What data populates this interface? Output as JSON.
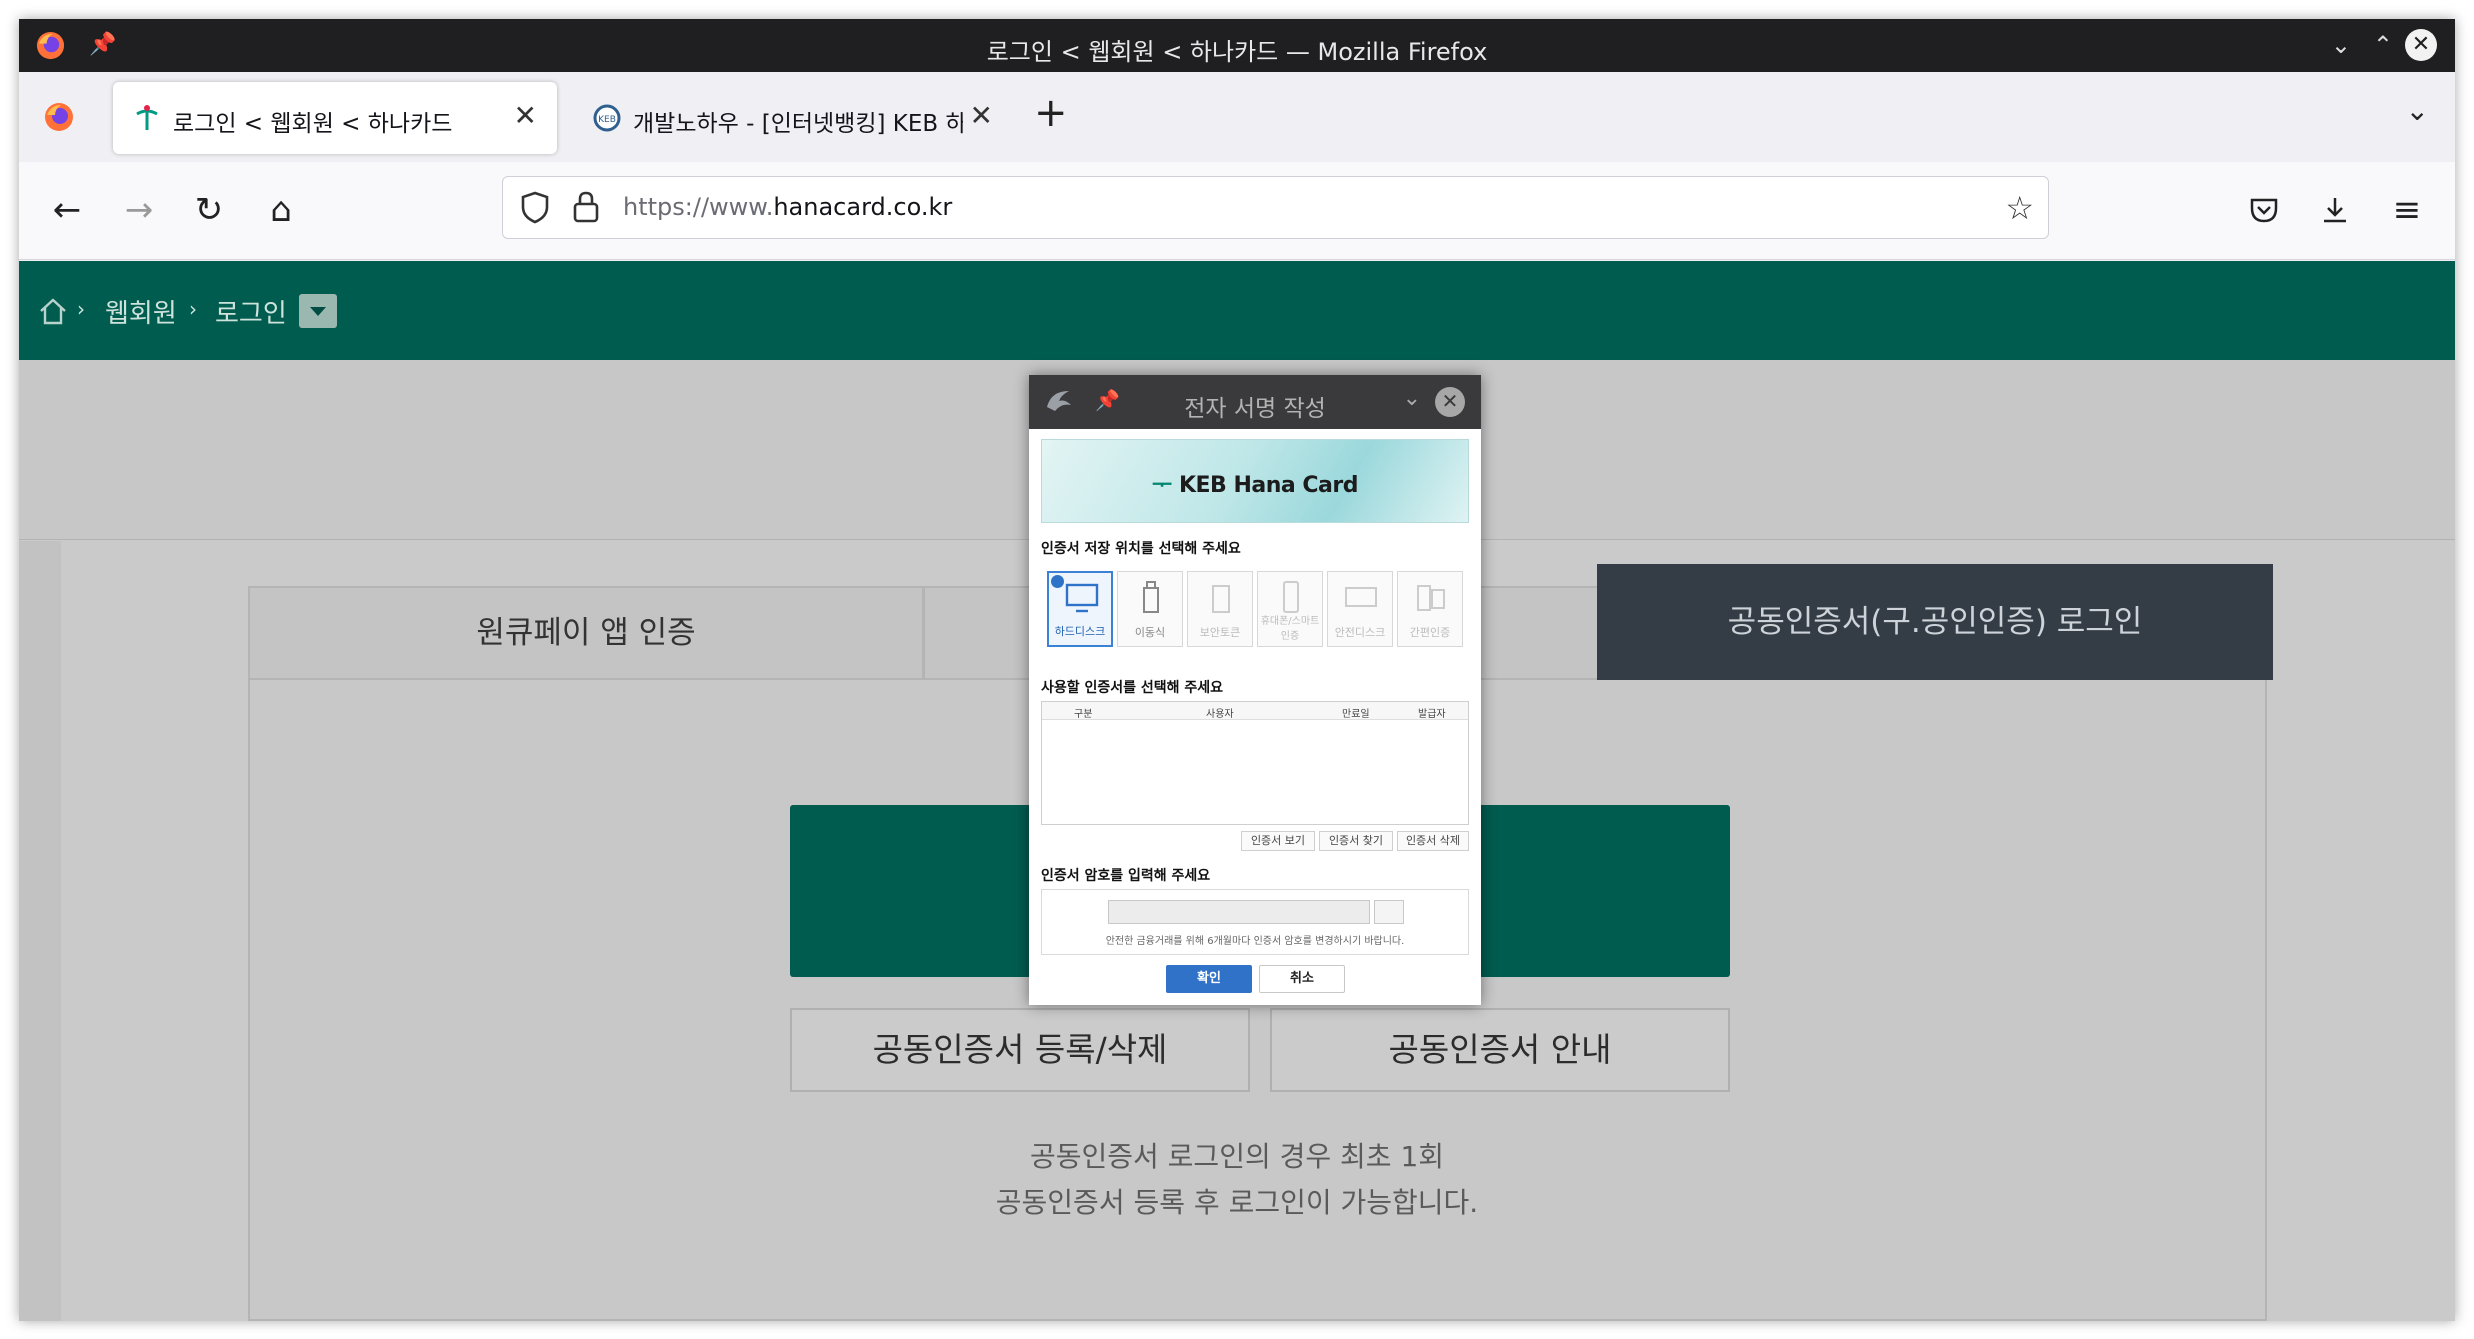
{
  "window": {
    "title": "로그인 < 웹회원 < 하나카드 — Mozilla Firefox"
  },
  "tabs": [
    {
      "label": "로그인 < 웹회원 < 하나카드",
      "active": true
    },
    {
      "label": "개발노하우 - [인터넷뱅킹] KEB 하나",
      "active": false
    }
  ],
  "address": {
    "scheme": "https://www.",
    "host": "hanacard.co.kr"
  },
  "breadcrumb": {
    "items": [
      "웹회원",
      "로그인"
    ]
  },
  "login_tabs": [
    {
      "label": "원큐페이 앱 인증"
    },
    {
      "label": ""
    },
    {
      "label": "공동인증서(구.공인인증) 로그인"
    }
  ],
  "buttons": {
    "register_delete": "공동인증서 등록/삭제",
    "guide": "공동인증서 안내"
  },
  "notice": {
    "line1": "공동인증서 로그인의 경우 최초 1회",
    "line2": "공동인증서 등록 후 로그인이 가능합니다."
  },
  "dialog": {
    "title": "전자 서명 작성",
    "banner": "KEB Hana Card",
    "storage_heading": "인증서 저장 위치를 선택해 주세요",
    "storage_options": [
      {
        "label": "하드디스크",
        "selected": true
      },
      {
        "label": "이동식",
        "selected": false
      },
      {
        "label": "보안토큰",
        "selected": false
      },
      {
        "label": "휴대폰/스마트인증",
        "selected": false
      },
      {
        "label": "안전디스크",
        "selected": false
      },
      {
        "label": "간편인증",
        "selected": false
      }
    ],
    "cert_heading": "사용할 인증서를 선택해 주세요",
    "columns": [
      "구분",
      "사용자",
      "만료일",
      "발급자"
    ],
    "cert_buttons": [
      "인증서 보기",
      "인증서 찾기",
      "인증서 삭제"
    ],
    "pw_heading": "인증서 암호를 입력해 주세요",
    "pw_note": "안전한 금융거래를 위해 6개월마다 인증서 암호를 변경하시기 바랍니다.",
    "ok": "확인",
    "cancel": "취소"
  }
}
